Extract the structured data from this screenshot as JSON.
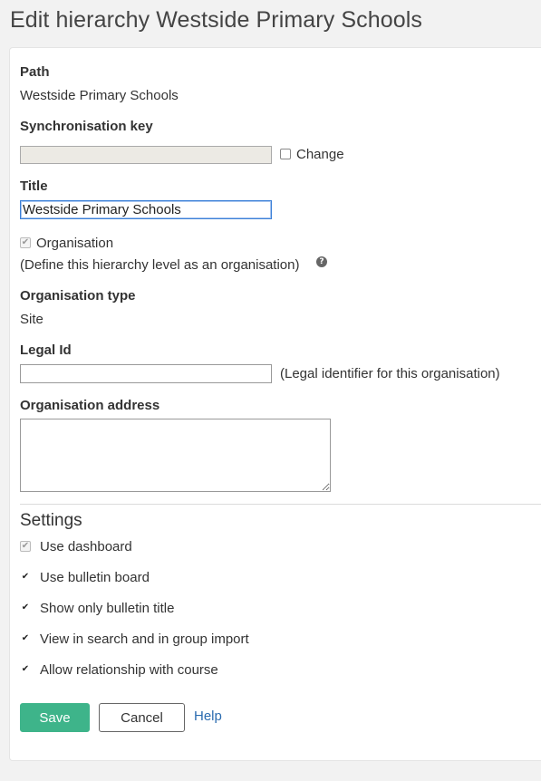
{
  "page": {
    "title": "Edit hierarchy Westside Primary Schools"
  },
  "form": {
    "path_label": "Path",
    "path_value": "Westside Primary Schools",
    "sync_key_label": "Synchronisation key",
    "sync_key_value": "",
    "change_label": "Change",
    "change_checked": false,
    "title_label": "Title",
    "title_value": "Westside Primary Schools",
    "organisation_label": "Organisation",
    "organisation_checked": true,
    "organisation_hint": "(Define this hierarchy level as an organisation)",
    "help_icon": "question-circle-icon",
    "org_type_label": "Organisation type",
    "org_type_value": "Site",
    "legal_id_label": "Legal Id",
    "legal_id_value": "",
    "legal_id_hint": "(Legal identifier for this organisation)",
    "org_address_label": "Organisation address",
    "org_address_value": ""
  },
  "settings": {
    "heading": "Settings",
    "items": [
      {
        "label": "Use dashboard",
        "checked": true,
        "disabled": true
      },
      {
        "label": "Use bulletin board",
        "checked": true,
        "disabled": false
      },
      {
        "label": "Show only bulletin title",
        "checked": true,
        "disabled": false
      },
      {
        "label": "View in search and in group import",
        "checked": true,
        "disabled": false
      },
      {
        "label": "Allow relationship with course",
        "checked": true,
        "disabled": false
      }
    ]
  },
  "actions": {
    "save_label": "Save",
    "cancel_label": "Cancel",
    "help_label": "Help",
    "save_color": "#3eb48a",
    "link_color": "#2b6cb0"
  }
}
